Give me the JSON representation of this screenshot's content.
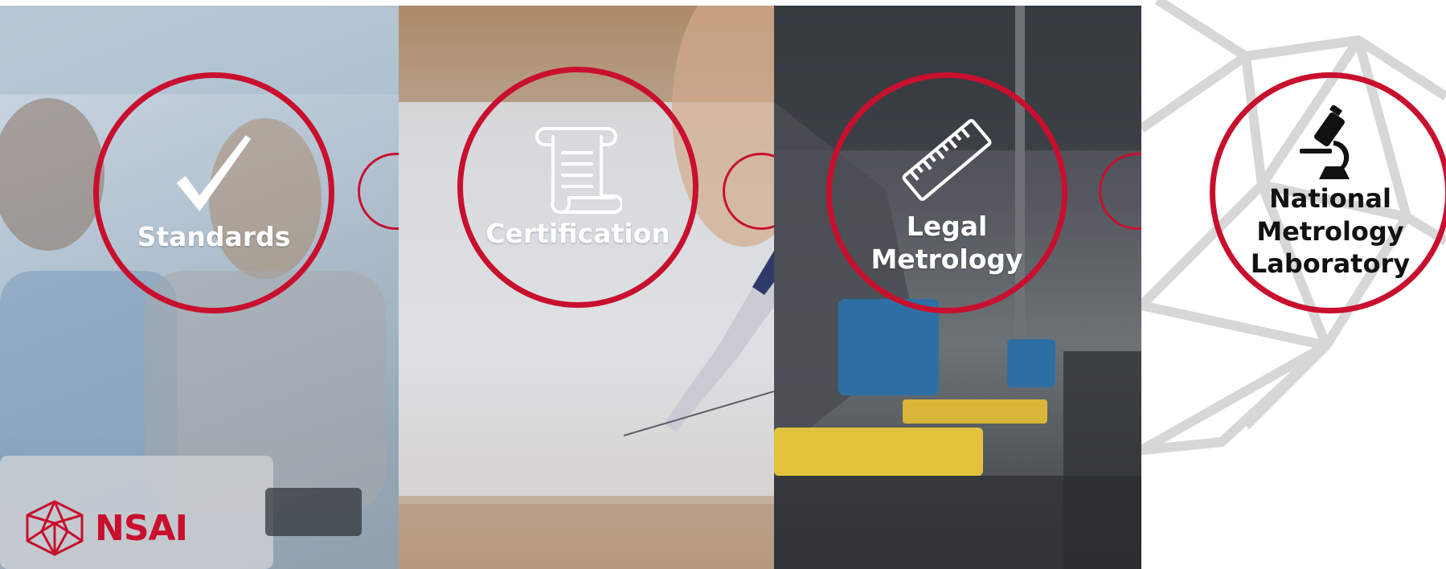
{
  "brand": {
    "name": "NSAI",
    "accent_color": "#c8102e",
    "logo_icon": "nsai-polyhedron-icon"
  },
  "services": [
    {
      "label": "Standards",
      "icon": "checkmark-icon"
    },
    {
      "label": "Certification",
      "icon": "scroll-icon"
    },
    {
      "label_lines": [
        "Legal",
        "Metrology"
      ],
      "icon": "ruler-icon"
    },
    {
      "label_lines": [
        "National",
        "Metrology",
        "Laboratory"
      ],
      "icon": "microscope-icon"
    }
  ]
}
